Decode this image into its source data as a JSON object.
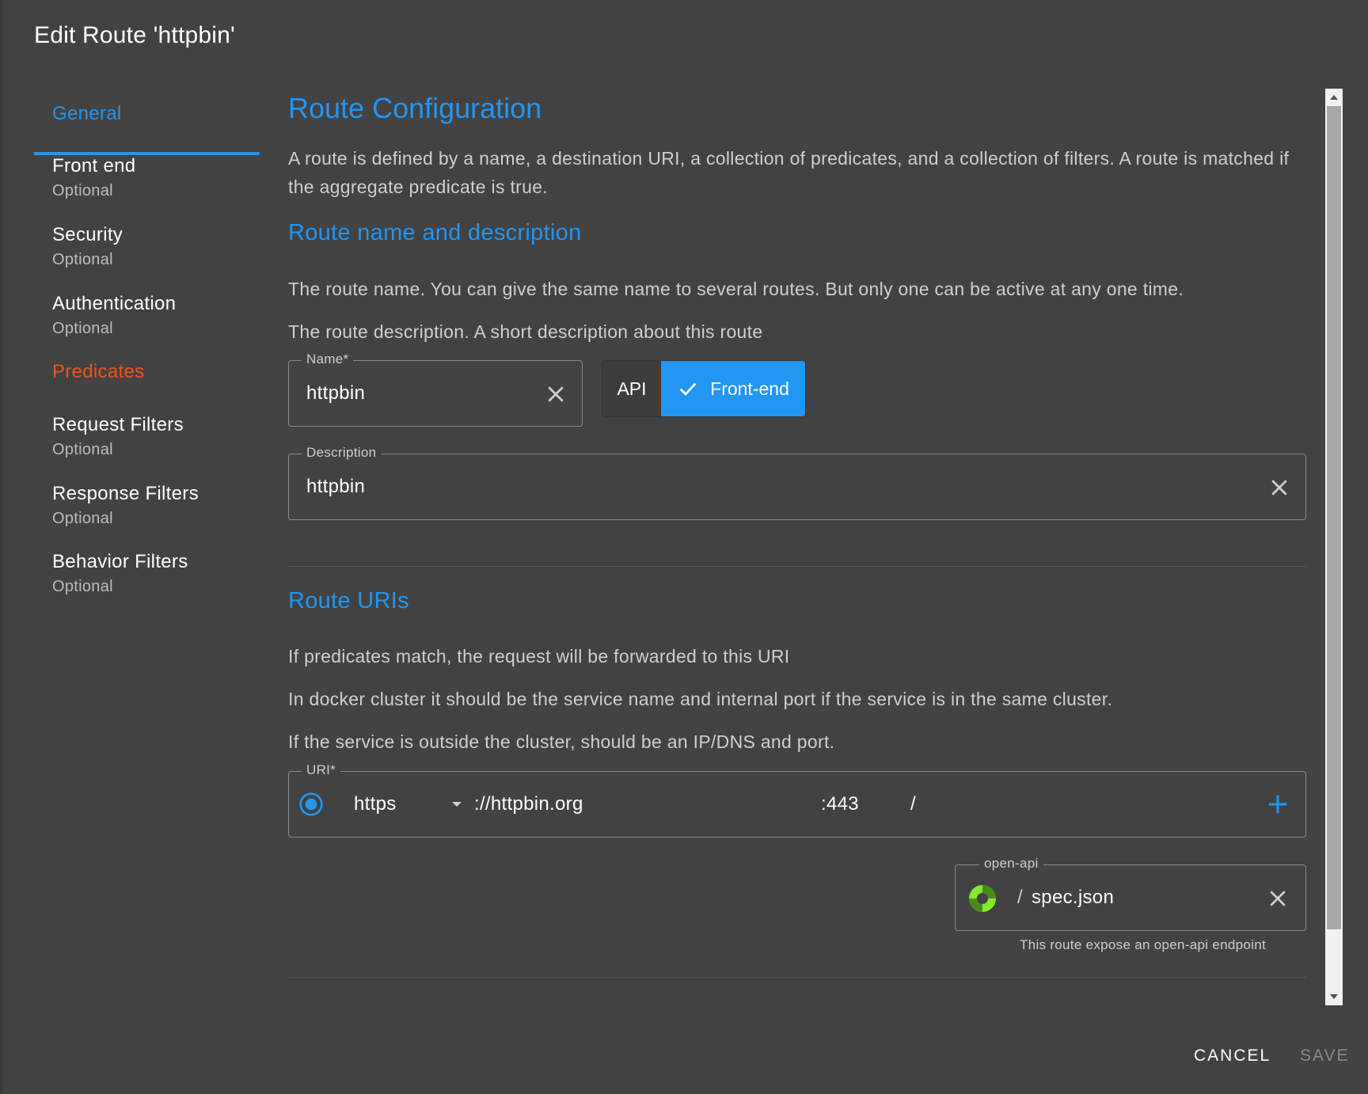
{
  "dialog": {
    "title": "Edit Route 'httpbin'"
  },
  "sidebar": {
    "items": [
      {
        "label": "General",
        "sub": ""
      },
      {
        "label": "Front end",
        "sub": "Optional"
      },
      {
        "label": "Security",
        "sub": "Optional"
      },
      {
        "label": "Authentication",
        "sub": "Optional"
      },
      {
        "label": "Predicates",
        "sub": ""
      },
      {
        "label": "Request Filters",
        "sub": "Optional"
      },
      {
        "label": "Response Filters",
        "sub": "Optional"
      },
      {
        "label": "Behavior Filters",
        "sub": "Optional"
      }
    ]
  },
  "content": {
    "title": "Route Configuration",
    "intro": "A route is defined by a name, a destination URI, a collection of predicates, and a collection of filters. A route is matched if the aggregate predicate is true.",
    "name_section": {
      "heading": "Route name and description",
      "text1": "The route name. You can give the same name to several routes. But only one can be active at any one time.",
      "text2": "The route description. A short description about this route",
      "name_label": "Name*",
      "name_value": "httpbin",
      "toggle_api": "API",
      "toggle_frontend": "Front-end",
      "description_label": "Description",
      "description_value": "httpbin"
    },
    "uri_section": {
      "heading": "Route URIs",
      "text1": "If predicates match, the request will be forwarded to this URI",
      "text2": "In docker cluster it should be the service name and internal port if the service is in the same cluster.",
      "text3": "If the service is outside the cluster, should be an IP/DNS and port.",
      "uri_label": "URI*",
      "scheme": "https",
      "host": "://httpbin.org",
      "port": ":443",
      "path": "/",
      "openapi_label": "open-api",
      "openapi_prefix": "/",
      "openapi_value": "spec.json",
      "openapi_hint": "This route expose an open-api endpoint"
    }
  },
  "actions": {
    "cancel": "CANCEL",
    "save": "SAVE"
  },
  "colors": {
    "accent": "#2196f3",
    "error": "#f4511e",
    "background": "#424242",
    "openapi_logo": "#85ea2d"
  }
}
